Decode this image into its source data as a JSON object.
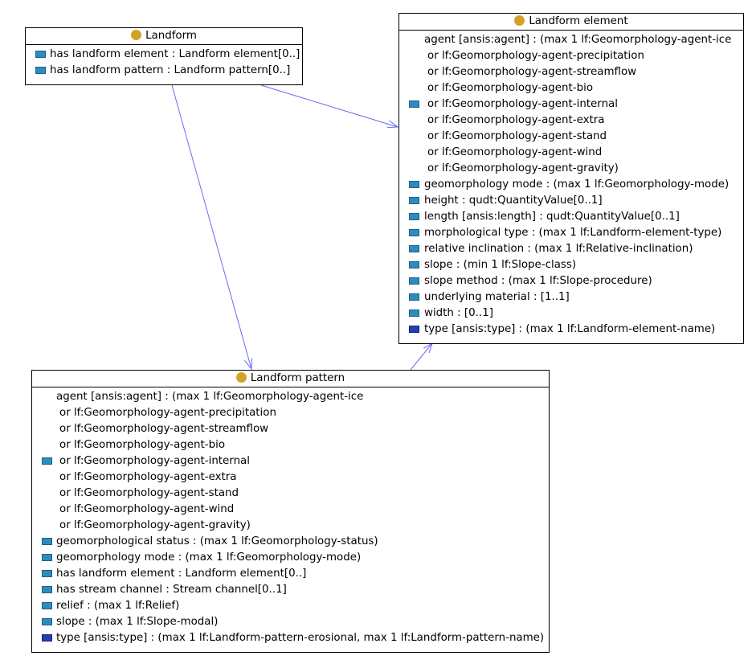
{
  "colors": {
    "class_dot": "#d4a22a",
    "property_icon": "#2e8bc0",
    "type_icon": "#2340b0",
    "edge": "#6b6bef"
  },
  "landform": {
    "title": "Landform",
    "attrs": [
      "has landform element : Landform element[0..]",
      "has landform pattern : Landform pattern[0..]"
    ]
  },
  "landform_element": {
    "title": "Landform element",
    "agent_lines": [
      "agent  [ansis:agent] :  (max 1 lf:Geomorphology-agent-ice",
      "or lf:Geomorphology-agent-precipitation",
      "or lf:Geomorphology-agent-streamflow",
      "or lf:Geomorphology-agent-bio",
      "or lf:Geomorphology-agent-internal",
      "or lf:Geomorphology-agent-extra",
      "or lf:Geomorphology-agent-stand",
      "or lf:Geomorphology-agent-wind",
      "or lf:Geomorphology-agent-gravity)"
    ],
    "attrs": [
      "geomorphology mode :  (max 1 lf:Geomorphology-mode)",
      "height : qudt:QuantityValue[0..1]",
      "length  [ansis:length] : qudt:QuantityValue[0..1]",
      "morphological type :  (max 1 lf:Landform-element-type)",
      "relative inclination :  (max 1 lf:Relative-inclination)",
      "slope :  (min 1 lf:Slope-class)",
      "slope method :  (max 1 lf:Slope-procedure)",
      "underlying material : [1..1]",
      "width : [0..1]",
      "type  [ansis:type] :  (max 1 lf:Landform-element-name)"
    ]
  },
  "landform_pattern": {
    "title": "Landform pattern",
    "agent_lines": [
      "agent  [ansis:agent] :  (max 1 lf:Geomorphology-agent-ice",
      "or lf:Geomorphology-agent-precipitation",
      "or lf:Geomorphology-agent-streamflow",
      "or lf:Geomorphology-agent-bio",
      "or lf:Geomorphology-agent-internal",
      "or lf:Geomorphology-agent-extra",
      "or lf:Geomorphology-agent-stand",
      "or lf:Geomorphology-agent-wind",
      "or lf:Geomorphology-agent-gravity)"
    ],
    "attrs": [
      "geomorphological status :  (max 1 lf:Geomorphology-status)",
      "geomorphology mode :  (max 1 lf:Geomorphology-mode)",
      "has landform element : Landform element[0..]",
      "has stream channel  : Stream channel[0..1]",
      "relief :  (max 1 lf:Relief)",
      "slope :  (max 1 lf:Slope-modal)",
      "type  [ansis:type] :  (max 1 lf:Landform-pattern-erosional, max 1 lf:Landform-pattern-name)"
    ]
  }
}
